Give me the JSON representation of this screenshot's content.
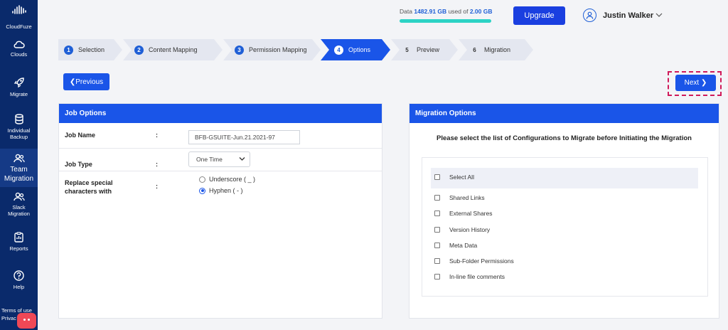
{
  "sidebar": {
    "brand": "CloudFuze",
    "items": [
      {
        "label": "Clouds",
        "icon": "cloud-icon"
      },
      {
        "label": "Migrate",
        "icon": "rocket-icon"
      },
      {
        "label": "Individual Backup",
        "icon": "database-icon"
      },
      {
        "label": "Team Migration",
        "icon": "team-icon"
      },
      {
        "label": "Slack Migration",
        "icon": "team-icon"
      },
      {
        "label": "Reports",
        "icon": "report-icon"
      },
      {
        "label": "Help",
        "icon": "help-icon"
      }
    ],
    "active_item": "Team Migration",
    "footer": {
      "terms": "Terms of use",
      "privacy": "Privac"
    }
  },
  "header": {
    "storage": {
      "prefix": "Data",
      "used": "1482.91 GB",
      "middle": "used of",
      "total": "2.00 GB"
    },
    "upgrade_label": "Upgrade",
    "user_name": "Justin Walker"
  },
  "stepper": {
    "steps": [
      {
        "num": "1",
        "label": "Selection",
        "state": "done"
      },
      {
        "num": "2",
        "label": "Content Mapping",
        "state": "done"
      },
      {
        "num": "3",
        "label": "Permission Mapping",
        "state": "done"
      },
      {
        "num": "4",
        "label": "Options",
        "state": "active"
      },
      {
        "num": "5",
        "label": "Preview",
        "state": "pending"
      },
      {
        "num": "6",
        "label": "Migration",
        "state": "pending"
      }
    ]
  },
  "nav": {
    "previous_label": "Previous",
    "next_label": "Next"
  },
  "job_options": {
    "title": "Job Options",
    "job_name_label": "Job Name",
    "job_name_value": "BFB-GSUITE-Jun.21.2021-97",
    "job_type_label": "Job Type",
    "job_type_value": "One Time",
    "replace_label_1": "Replace special",
    "replace_label_2": "characters with",
    "colon": ":",
    "options": [
      {
        "label": "Underscore ( _ )",
        "selected": false
      },
      {
        "label": "Hyphen ( - )",
        "selected": true
      }
    ]
  },
  "migration_options": {
    "title": "Migration Options",
    "instruction": "Please select the list of Configurations to Migrate before Initiating the Migration",
    "select_all": "Select All",
    "configs": [
      "Shared Links",
      "External Shares",
      "Version History",
      "Meta Data",
      "Sub-Folder Permissions",
      "In-line file comments"
    ]
  },
  "colors": {
    "primary": "#1a55e8",
    "sidebar": "#0a2a6b",
    "highlight": "#d01a5a"
  }
}
